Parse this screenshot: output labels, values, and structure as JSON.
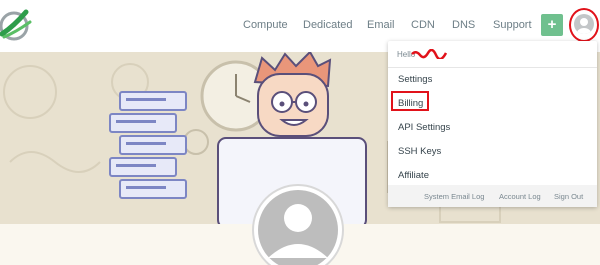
{
  "nav": {
    "items": [
      "Compute",
      "Dedicated",
      "Email",
      "CDN",
      "DNS",
      "Support"
    ],
    "add_label": "+"
  },
  "colors": {
    "accent_green": "#6fc08e",
    "highlight_red": "#e1121a",
    "hero_bg": "#e8e1cf"
  },
  "dropdown": {
    "hello": "Hello",
    "items": [
      "Settings",
      "Billing",
      "API Settings",
      "SSH Keys",
      "Affiliate"
    ],
    "footer_links": [
      "System Email Log",
      "Account Log",
      "Sign Out"
    ]
  }
}
